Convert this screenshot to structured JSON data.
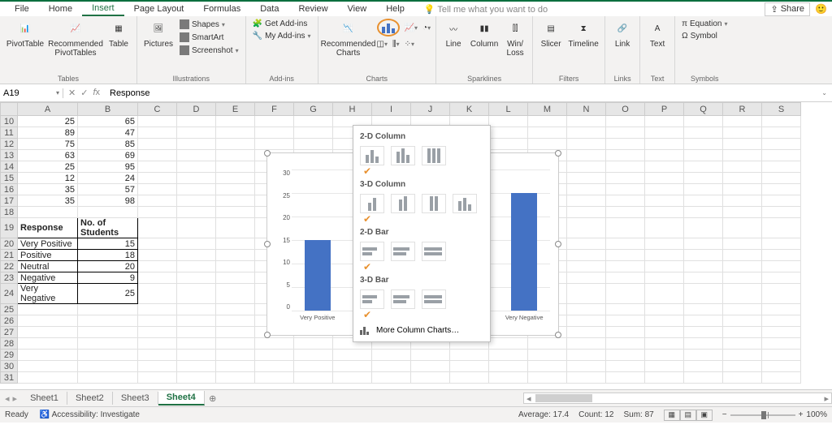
{
  "menu": {
    "tabs": [
      "File",
      "Home",
      "Insert",
      "Page Layout",
      "Formulas",
      "Data",
      "Review",
      "View",
      "Help"
    ],
    "tell_me": "Tell me what you want to do",
    "share": "Share"
  },
  "ribbon": {
    "tables": {
      "label": "Tables",
      "pivot": "PivotTable",
      "recpivot": "Recommended\nPivotTables",
      "table": "Table"
    },
    "illus": {
      "label": "Illustrations",
      "pictures": "Pictures",
      "shapes": "Shapes",
      "smartart": "SmartArt",
      "screenshot": "Screenshot"
    },
    "addins": {
      "label": "Add-ins",
      "get": "Get Add-ins",
      "my": "My Add-ins"
    },
    "charts": {
      "label": "Charts",
      "rec": "Recommended\nCharts"
    },
    "spark": {
      "label": "Sparklines",
      "line": "Line",
      "col": "Column",
      "wl": "Win/\nLoss"
    },
    "filters": {
      "label": "Filters",
      "slicer": "Slicer",
      "tl": "Timeline"
    },
    "links": {
      "label": "Links",
      "link": "Link"
    },
    "text": {
      "label": "Text",
      "text": "Text"
    },
    "symbols": {
      "label": "Symbols",
      "eq": "Equation",
      "sym": "Symbol"
    }
  },
  "namebox": "A19",
  "formula": "Response",
  "columns": [
    "A",
    "B",
    "C",
    "D",
    "E",
    "F",
    "G",
    "H",
    "I",
    "J",
    "K",
    "L",
    "M",
    "N",
    "O",
    "P",
    "Q",
    "R",
    "S"
  ],
  "rows_top": [
    {
      "n": 10,
      "a": "25",
      "b": "65"
    },
    {
      "n": 11,
      "a": "89",
      "b": "47"
    },
    {
      "n": 12,
      "a": "75",
      "b": "85"
    },
    {
      "n": 13,
      "a": "63",
      "b": "69"
    },
    {
      "n": 14,
      "a": "25",
      "b": "95"
    },
    {
      "n": 15,
      "a": "12",
      "b": "24"
    },
    {
      "n": 16,
      "a": "35",
      "b": "57"
    },
    {
      "n": 17,
      "a": "35",
      "b": "98"
    }
  ],
  "table": {
    "hdr_a": "Response",
    "hdr_b": "No. of Students",
    "rows": [
      {
        "n": 20,
        "a": "Very Positive",
        "b": "15"
      },
      {
        "n": 21,
        "a": "Positive",
        "b": "18"
      },
      {
        "n": 22,
        "a": "Neutral",
        "b": "20"
      },
      {
        "n": 23,
        "a": "Negative",
        "b": "9"
      },
      {
        "n": 24,
        "a": "Very Negative",
        "b": "25"
      }
    ]
  },
  "popup": {
    "s1": "2-D Column",
    "s2": "3-D Column",
    "s3": "2-D Bar",
    "s4": "3-D Bar",
    "more": "More Column Charts…"
  },
  "chart_data": {
    "type": "bar",
    "categories": [
      "Very Positive",
      "Positive",
      "Neutral",
      "Negative",
      "Very Negative"
    ],
    "values": [
      15,
      18,
      20,
      9,
      25
    ],
    "ylim": [
      0,
      30
    ],
    "yticks": [
      0,
      5,
      10,
      15,
      20,
      25,
      30
    ],
    "title": "",
    "xlabel": "",
    "ylabel": ""
  },
  "sheets": [
    "Sheet1",
    "Sheet2",
    "Sheet3",
    "Sheet4"
  ],
  "status": {
    "ready": "Ready",
    "acc": "Accessibility: Investigate",
    "avg": "Average: 17.4",
    "count": "Count: 12",
    "sum": "Sum: 87",
    "zoom": "100%"
  }
}
